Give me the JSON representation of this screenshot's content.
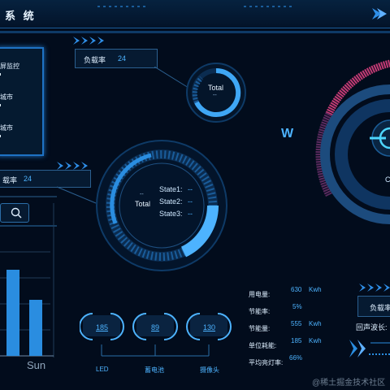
{
  "header": {
    "title": "系 统"
  },
  "load_box_top": {
    "label": "负载率",
    "value": "24"
  },
  "load_box_mid": {
    "label": "载率",
    "value": "24"
  },
  "load_box_right": {
    "label": "负载率"
  },
  "left_panel": {
    "items": [
      "屏监控",
      "城市",
      "城市"
    ]
  },
  "small_gauge": {
    "label": "Total",
    "value": "--"
  },
  "big_gauge": {
    "label": "Total",
    "value": "--",
    "states": [
      {
        "label": "State1:",
        "value": "--"
      },
      {
        "label": "State2:",
        "value": "--"
      },
      {
        "label": "State3:",
        "value": "--"
      }
    ]
  },
  "chart_data": {
    "type": "bar",
    "categories": [
      "Sun"
    ],
    "visible_label": "Sun",
    "values": [
      0.85,
      0.55
    ],
    "title": "",
    "xlabel": "",
    "ylabel": ""
  },
  "stats": [
    {
      "label": "用电量:",
      "value": "630",
      "unit": "Kwh"
    },
    {
      "label": "节能率:",
      "value": "5%",
      "unit": ""
    },
    {
      "label": "节能量:",
      "value": "555",
      "unit": "Kwh"
    },
    {
      "label": "单位耗能:",
      "value": "185",
      "unit": "Kwh"
    },
    {
      "label": "平均亮灯率:",
      "value": "66%",
      "unit": ""
    }
  ],
  "gauges": [
    {
      "value": "185",
      "label": "LED"
    },
    {
      "value": "89",
      "label": "蓄电池"
    },
    {
      "value": "130",
      "label": "摄像头"
    }
  ],
  "right": {
    "echo_label": "回声波长:",
    "c_label": "C"
  },
  "watermark": "@稀土掘金技术社区",
  "colors": {
    "accent": "#2a8de0",
    "magenta": "#d0407a",
    "panel": "#061a31"
  }
}
